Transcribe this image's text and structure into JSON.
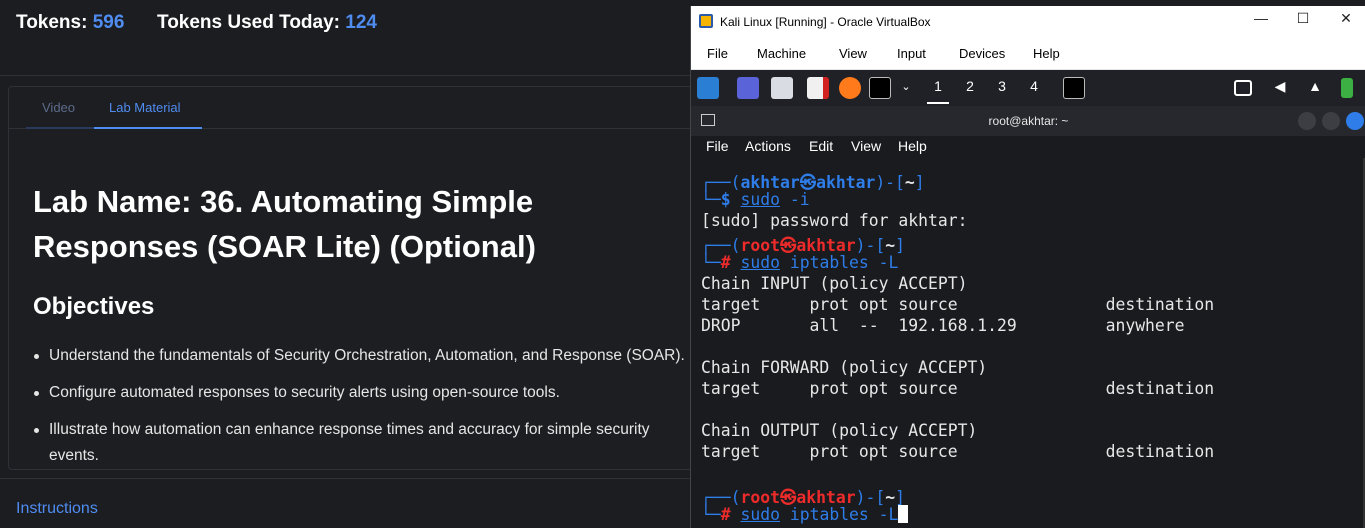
{
  "header": {
    "tokens_label": "Tokens:",
    "tokens_value": "596",
    "tokens_today_label": "Tokens Used Today:",
    "tokens_today_value": "124"
  },
  "tabs": [
    {
      "label": "Video"
    },
    {
      "label": "Lab Material"
    }
  ],
  "lab": {
    "title": "Lab Name: 36. Automating Simple Responses (SOAR Lite) (Optional)",
    "objectives_heading": "Objectives",
    "objectives": [
      "Understand the fundamentals of Security Orchestration, Automation, and Response (SOAR).",
      "Configure automated responses to security alerts using open-source tools.",
      "Illustrate how automation can enhance response times and accuracy for simple security events."
    ]
  },
  "instructions_link": "Instructions",
  "vbox": {
    "title": "Kali Linux [Running] - Oracle VirtualBox",
    "controls": {
      "minimize": "—",
      "maximize": "☐",
      "close": "✕"
    },
    "menu": [
      "File",
      "Machine",
      "View",
      "Input",
      "Devices",
      "Help"
    ],
    "workspaces": [
      "1",
      "2",
      "3",
      "4"
    ],
    "active_workspace": "1"
  },
  "terminal": {
    "title": "root@akhtar: ~",
    "menu": [
      "File",
      "Actions",
      "Edit",
      "View",
      "Help"
    ],
    "prompt1": {
      "user": "akhtar",
      "host": "akhtar",
      "dir": "~",
      "cmd": "sudo",
      "args": " -i"
    },
    "sudo_line": "[sudo] password for akhtar:",
    "prompt2": {
      "user": "root",
      "host": "akhtar",
      "dir": "~",
      "cmd": "sudo",
      "args": " iptables -L"
    },
    "output": [
      "Chain INPUT (policy ACCEPT)",
      "target     prot opt source               destination",
      "DROP       all  --  192.168.1.29         anywhere",
      "",
      "Chain FORWARD (policy ACCEPT)",
      "target     prot opt source               destination",
      "",
      "Chain OUTPUT (policy ACCEPT)",
      "target     prot opt source               destination"
    ],
    "prompt3": {
      "user": "root",
      "host": "akhtar",
      "dir": "~",
      "cmd": "sudo",
      "args": " iptables -L"
    }
  }
}
